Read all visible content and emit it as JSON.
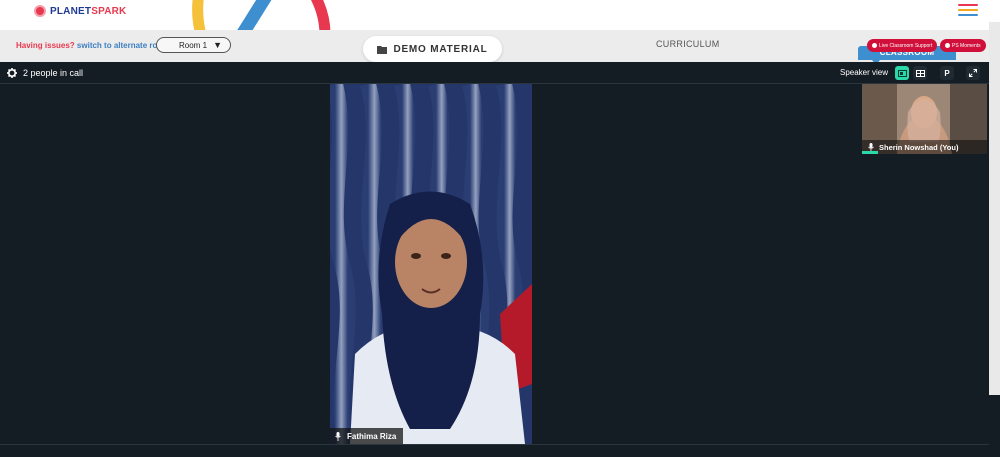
{
  "brand": {
    "name_part1": "PLANET",
    "name_part2": "SPARK"
  },
  "topbar": {
    "menu_icon": "hamburger-menu-icon",
    "menu_colors": [
      "#e8384f",
      "#f5a623",
      "#3e8fd0"
    ]
  },
  "issue_bar": {
    "issue_text": "Having issues?",
    "switch_link": "switch to alternate room",
    "room_select": {
      "value": "Room 1",
      "icon": "caret-down-icon"
    }
  },
  "demo_material": {
    "label": "DEMO MATERIAL",
    "icon": "folder-icon"
  },
  "curriculum": {
    "label": "CURRICULUM"
  },
  "classroom_tab": {
    "label": "CLASSROOM"
  },
  "support_buttons": [
    {
      "label": "Live Classroom Support",
      "icon": "plus-circle-icon"
    },
    {
      "label": "PS Moments",
      "icon": "plus-circle-icon"
    }
  ],
  "call": {
    "people_count": "2 people in call",
    "settings_icon": "gear-icon",
    "view_label": "Speaker view",
    "view_controls": [
      {
        "name": "speaker-layout-icon",
        "active": true
      },
      {
        "name": "grid-layout-icon",
        "active": false
      },
      {
        "name": "p-button",
        "label": "P",
        "active": false
      },
      {
        "name": "fullscreen-icon",
        "active": false
      }
    ],
    "main_participant": {
      "name": "Fathima Riza",
      "mic_icon": "microphone-icon"
    },
    "self_participant": {
      "name": "Sherin Nowshad (You)",
      "mic_icon": "microphone-icon"
    }
  },
  "colors": {
    "accent": "#2bd9a8",
    "brand_red": "#e8384f",
    "brand_blue": "#3e8fd0",
    "call_bg": "#151d24",
    "pill_red": "#d0103a"
  }
}
